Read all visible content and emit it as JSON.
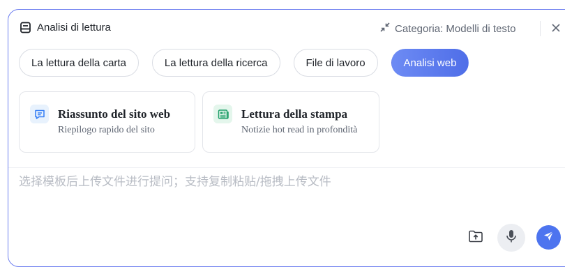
{
  "header": {
    "title": "Analisi di lettura",
    "title_icon": "document-lines-icon",
    "category_label": "Categoria: Modelli di testo",
    "collapse_icon": "collapse-arrows-icon",
    "close_icon": "close-icon"
  },
  "tabs": [
    {
      "label": "La lettura della carta",
      "active": false
    },
    {
      "label": "La lettura della ricerca",
      "active": false
    },
    {
      "label": "File di lavoro",
      "active": false
    },
    {
      "label": "Analisi web",
      "active": true
    }
  ],
  "cards": [
    {
      "title": "Riassunto del sito web",
      "subtitle": "Riepilogo rapido del sito",
      "icon": "chat-bubble-icon",
      "icon_color": "#3b82f6",
      "icon_bg": "#e8f2fd"
    },
    {
      "title": "Lettura della stampa",
      "subtitle": "Notizie hot read in profondità",
      "icon": "newspaper-icon",
      "icon_color": "#22a06b",
      "icon_bg": "#e4f6ec"
    }
  ],
  "input": {
    "placeholder": "选择模板后上传文件进行提问；支持复制粘贴/拖拽上传文件",
    "value": ""
  },
  "actions": {
    "upload_icon": "folder-upload-icon",
    "mic_icon": "microphone-icon",
    "send_icon": "send-icon"
  },
  "colors": {
    "accent": "#4d74ef",
    "frame_border": "#6e7ff0",
    "active_tab_gradient": [
      "#6d8bf4",
      "#4f6ee8"
    ]
  }
}
